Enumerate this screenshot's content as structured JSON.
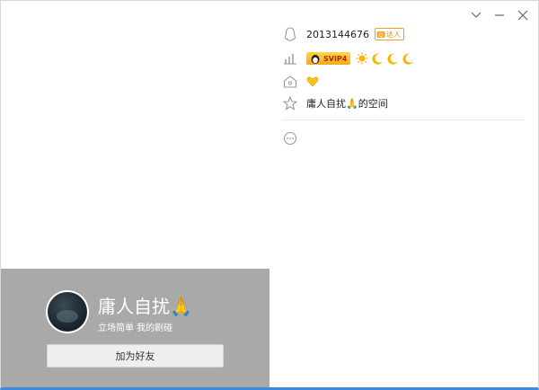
{
  "window": {
    "controls": {
      "collapse_glyph": "⌄",
      "minimize_glyph": "—",
      "close_glyph": "✕"
    }
  },
  "profile": {
    "nickname": "庸人自扰🙏",
    "signature": "立场简单 我的剧碰",
    "add_friend_label": "加为好友"
  },
  "info": {
    "qq_number": "2013144676",
    "talent_badge": "达人",
    "svip_label": "SVIP4",
    "level_icons": [
      "sun-icon",
      "moon-icon",
      "moon-icon",
      "moon-icon"
    ],
    "space_name": "庸人自扰🙏的空间"
  },
  "colors": {
    "card_bg": "#a9a9a9",
    "accent_bottom": "#3a8be0",
    "icon_gray": "#9a9a9a"
  }
}
